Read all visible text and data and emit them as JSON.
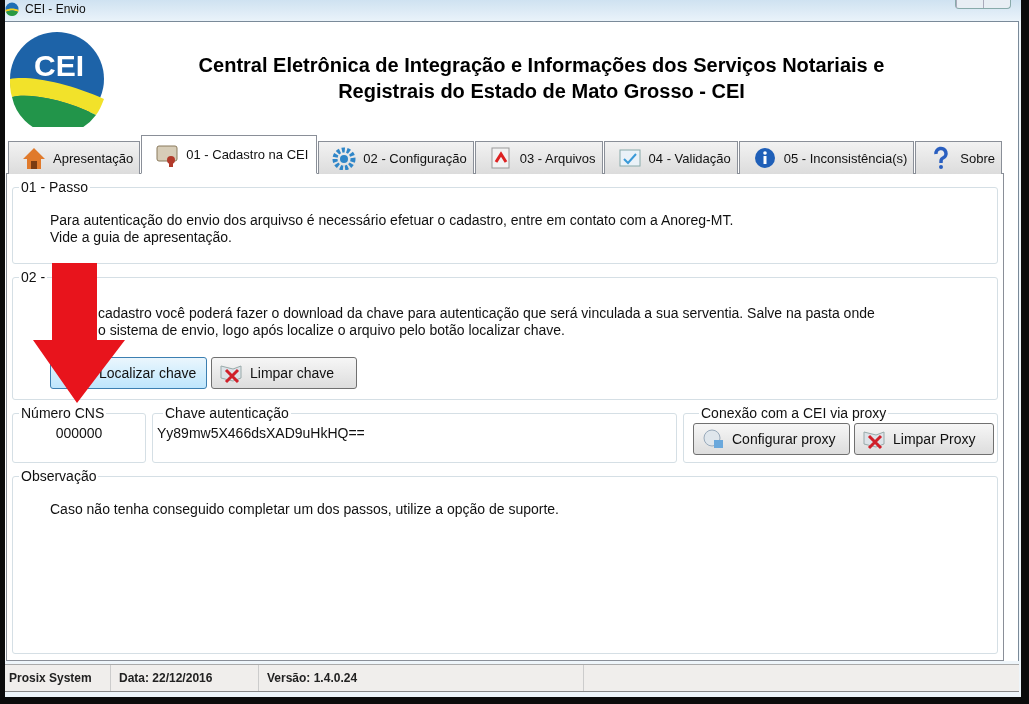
{
  "window": {
    "title": "CEI - Envio"
  },
  "header": {
    "logo_text": "CEI",
    "title_lines": [
      "Central Eletrônica de Integração e Informações dos Serviços Notariais e",
      "Registrais do Estado de Mato Grosso - CEI"
    ]
  },
  "tabs": [
    {
      "label": "Apresentação",
      "selected": false
    },
    {
      "label": "01 - Cadastro na CEI",
      "selected": true
    },
    {
      "label": "02 - Configuração",
      "selected": false
    },
    {
      "label": "03 - Arquivos",
      "selected": false
    },
    {
      "label": "04 - Validação",
      "selected": false
    },
    {
      "label": "05 - Inconsistência(s)",
      "selected": false
    },
    {
      "label": "Sobre",
      "selected": false
    }
  ],
  "step_1": {
    "legend": "01 - Passo",
    "lines": [
      "Para autenticação do envio dos arquivso é necessário efetuar o cadastro, entre em contato com a Anoreg-MT.",
      "Vide a guia de apresentação."
    ]
  },
  "step_2": {
    "legend": "02 -",
    "line_1_rest": "cadastro você poderá fazer o download da chave para autenticação que será vinculada a sua serventia.  Salve na pasta onde",
    "line_2_rest": "o sistema de envio,  logo após localize o arquivo pelo botão localizar chave.",
    "buttons": [
      {
        "label": "Localizar chave",
        "focused": true
      },
      {
        "label": "Limpar chave",
        "focused": false
      }
    ]
  },
  "cns": {
    "legend": "Número CNS",
    "value": "000000"
  },
  "key": {
    "legend": "Chave autenticação",
    "value": "Yy89mw5X466dsXAD9uHkHQ=="
  },
  "proxy": {
    "legend": "Conexão com a CEI via proxy",
    "buttons": [
      {
        "label": "Configurar proxy",
        "focused": false
      },
      {
        "label": "Limpar Proxy",
        "focused": false
      }
    ]
  },
  "observation": {
    "legend": "Observação",
    "text": "Caso não tenha conseguido completar um dos passos, utilize a opção de suporte."
  },
  "status_bar": [
    "Prosix System",
    "Data: 22/12/2016",
    "Versão: 1.4.0.24"
  ]
}
